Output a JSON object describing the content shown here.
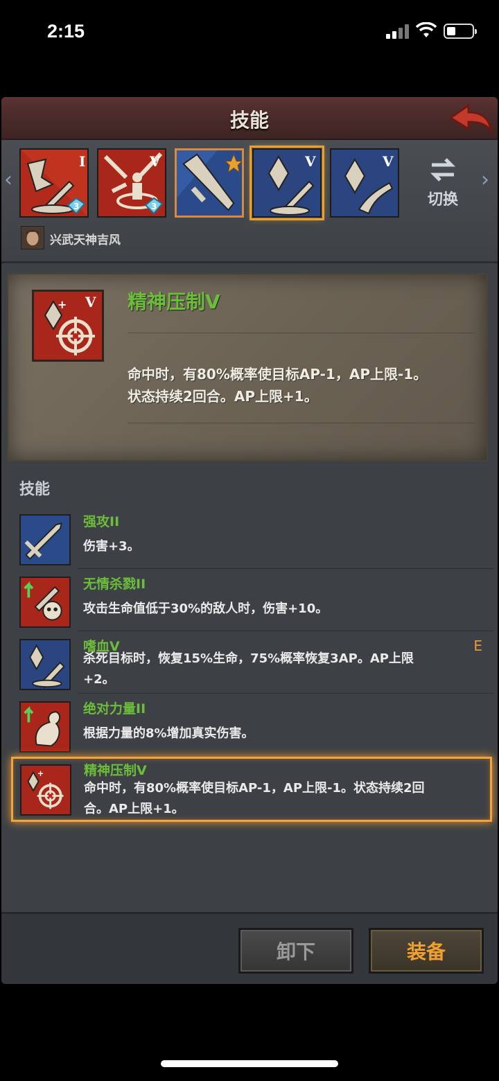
{
  "status": {
    "time": "2:15"
  },
  "header": {
    "title": "技能"
  },
  "strip": {
    "tiles": [
      {
        "roman": "I",
        "badge": "3"
      },
      {
        "roman": "V",
        "badge": "3"
      },
      {
        "roman": ""
      },
      {
        "roman": "V"
      },
      {
        "roman": "V"
      }
    ],
    "switch_label": "切换",
    "hero_name": "兴武天神吉风"
  },
  "detail": {
    "roman": "V",
    "name": "精神压制V",
    "desc_line1": "命中时，有80%概率使目标AP-1，AP上限-1。",
    "desc_line2": "状态持续2回合。AP上限+1。"
  },
  "skills_section": {
    "label": "技能"
  },
  "skills": [
    {
      "name": "强攻II",
      "desc": "伤害+3。"
    },
    {
      "name": "无情杀戮II",
      "desc": "攻击生命值低于30%的敌人时，伤害+10。"
    },
    {
      "name": "嗜血V",
      "desc": "杀死目标时，恢复15%生命，75%概率恢复3AP。AP上限+2。",
      "badge": "E"
    },
    {
      "name": "绝对力量II",
      "desc": "根据力量的8%增加真实伤害。"
    },
    {
      "name": "精神压制V",
      "desc": "命中时，有80%概率使目标AP-1，AP上限-1。状态持续2回合。AP上限+1。"
    }
  ],
  "buttons": {
    "unequip": "卸下",
    "equip": "装备"
  },
  "colors": {
    "skill_name": "#6bbd3a",
    "selected": "#f3a33a",
    "equip_text": "#f0a030"
  }
}
